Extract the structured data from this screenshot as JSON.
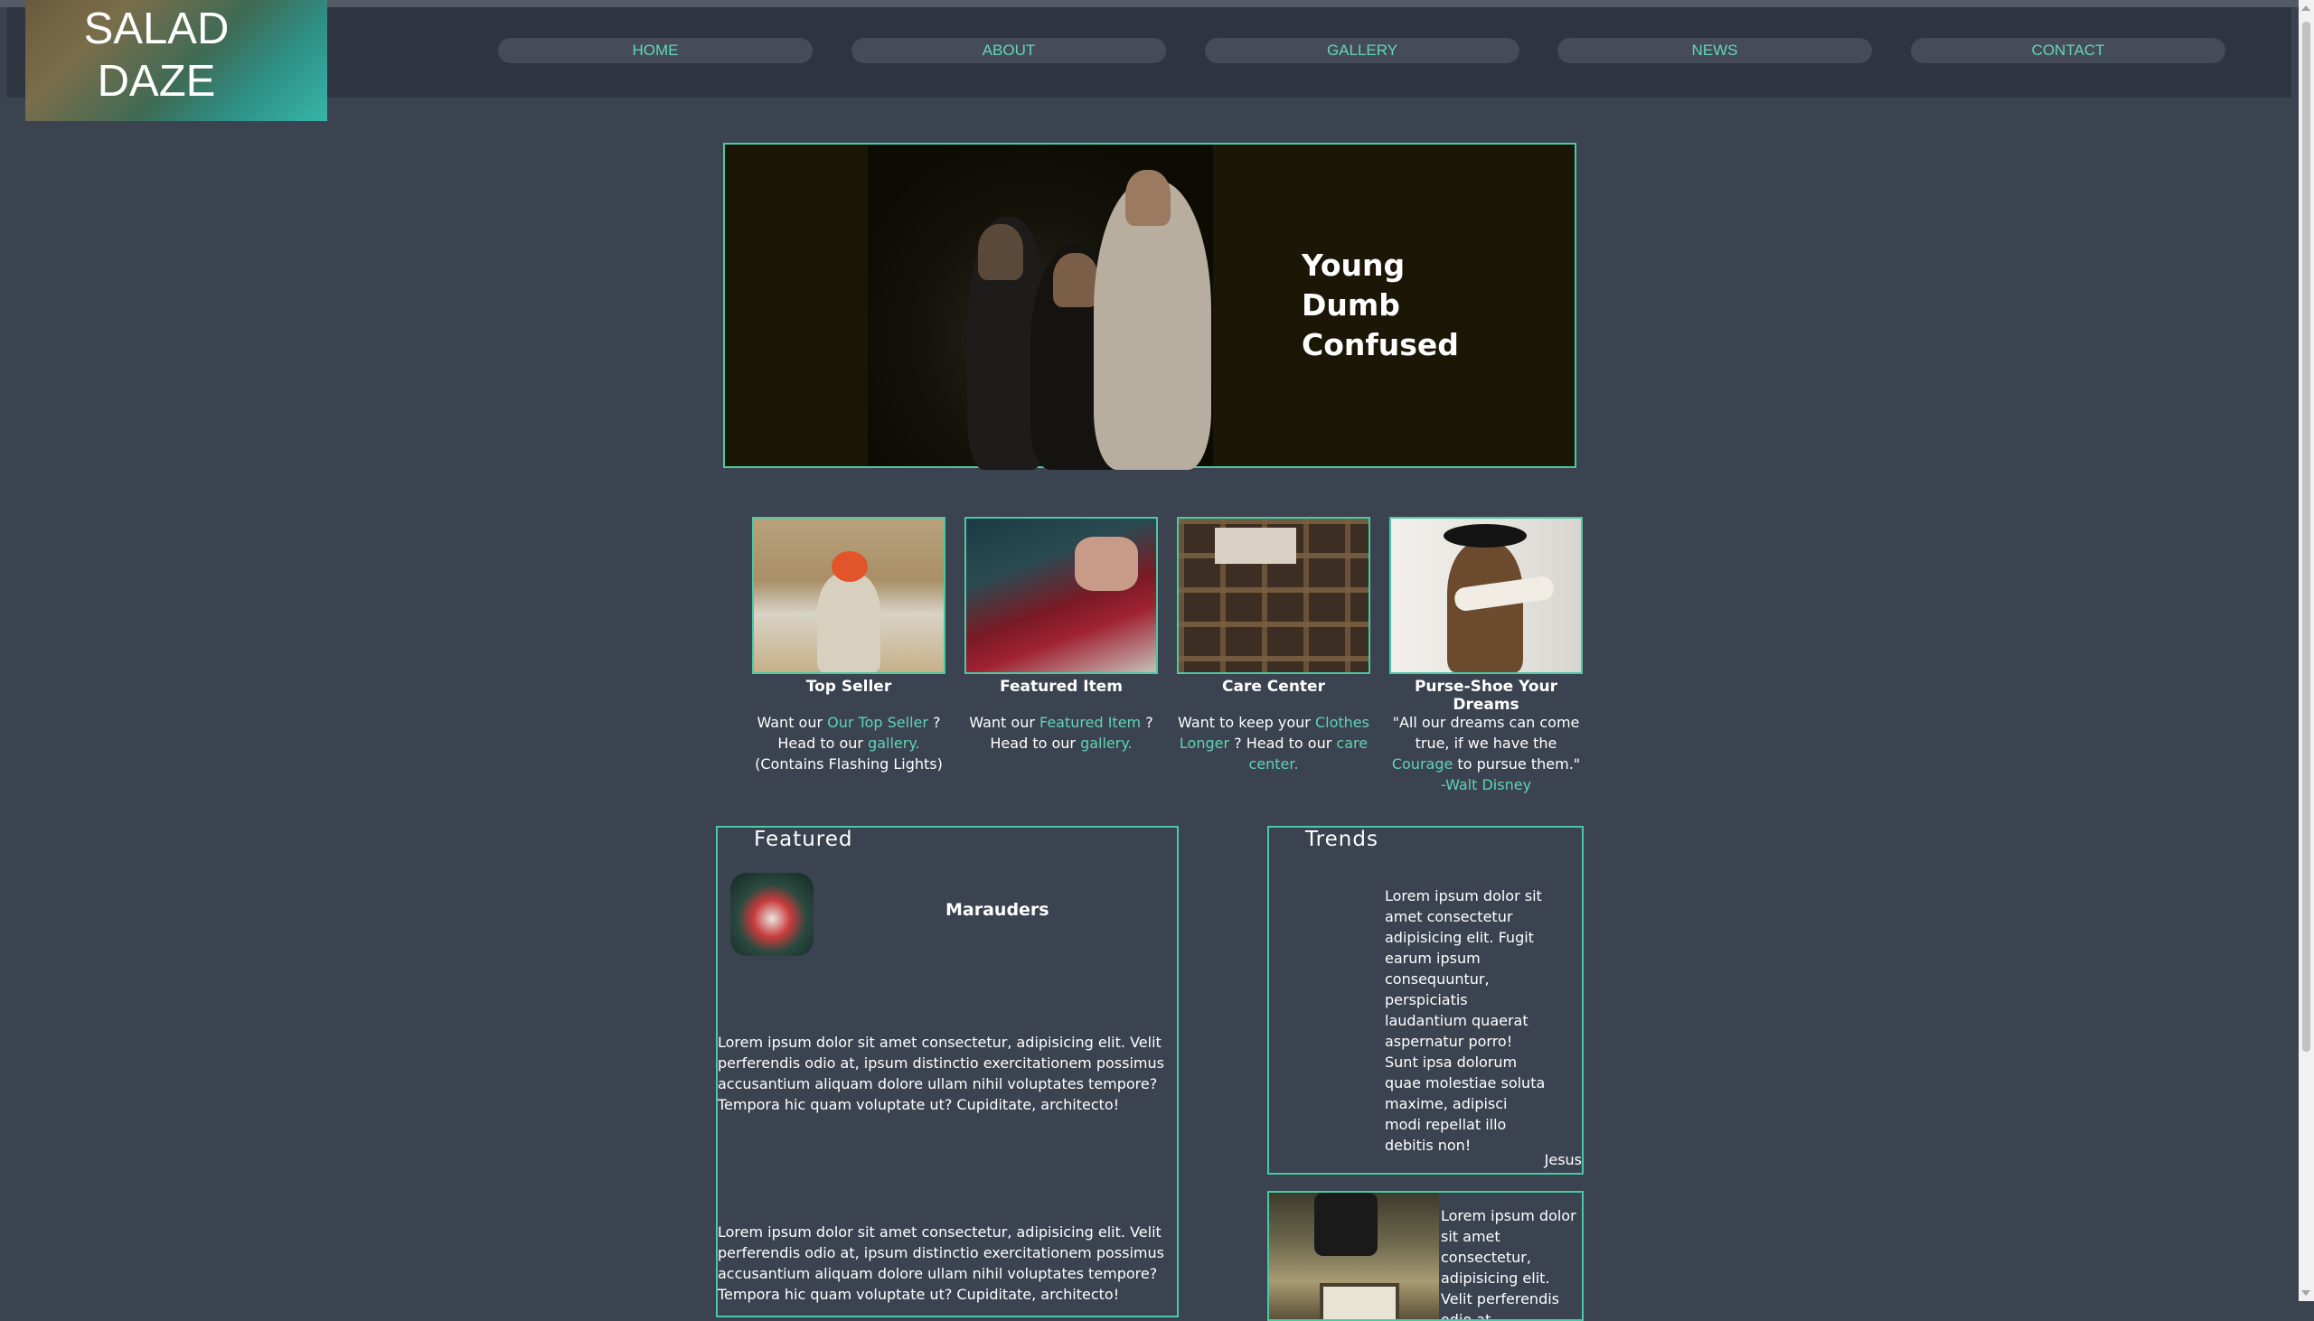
{
  "logo": {
    "line1": "SALAD",
    "line2": "DAZE"
  },
  "nav": [
    {
      "label": "HOME"
    },
    {
      "label": "ABOUT"
    },
    {
      "label": "GALLERY"
    },
    {
      "label": "NEWS"
    },
    {
      "label": "CONTACT"
    }
  ],
  "hero": {
    "line1": "Young",
    "line2": "Dumb",
    "line3": "Confused"
  },
  "cards": [
    {
      "title": "Top Seller",
      "p1": "Want our ",
      "link1": "Our Top Seller",
      "p2": " ?",
      "p3": "Head to our ",
      "link2": "gallery.",
      "p4": "(Contains Flashing Lights)"
    },
    {
      "title": "Featured Item",
      "p1": "Want our ",
      "link1": "Featured Item",
      "p2": " ?",
      "p3": "Head to our ",
      "link2": "gallery."
    },
    {
      "title": "Care Center",
      "p1": "Want to keep your ",
      "link1": "Clothes Longer",
      "p2": " ? Head to our ",
      "link2": "care center."
    },
    {
      "title": "Purse-Shoe Your Dreams",
      "p1": "\"All our dreams can come true, if we have the ",
      "link1": "Courage",
      "p2": " to pursue them.\" ",
      "link2": "-Walt Disney"
    }
  ],
  "featured": {
    "title": "Featured",
    "item_name": "Marauders",
    "para1": "Lorem ipsum dolor sit amet consectetur, adipisicing elit. Velit perferendis odio at, ipsum distinctio exercitationem possimus accusantium aliquam dolore ullam nihil voluptates tempore? Tempora hic quam voluptate ut? Cupiditate, architecto!",
    "para2": "Lorem ipsum dolor sit amet consectetur, adipisicing elit. Velit perferendis odio at, ipsum distinctio exercitationem possimus accusantium aliquam dolore ullam nihil voluptates tempore? Tempora hic quam voluptate ut? Cupiditate, architecto!"
  },
  "trends": {
    "title": "Trends",
    "text": "Lorem ipsum dolor sit amet consectetur adipisicing elit. Fugit earum ipsum consequuntur, perspiciatis laudantium quaerat aspernatur porro! Sunt ipsa dolorum quae molestiae soluta maxime, adipisci modi repellat illo debitis non!",
    "author": "Jesus",
    "text2": "Lorem ipsum dolor sit amet consectetur, adipisicing elit. Velit perferendis odio at,"
  },
  "colors": {
    "accent": "#49c9a4",
    "link": "#5fd4b4",
    "background": "#3b4350",
    "header": "#2e3540"
  }
}
